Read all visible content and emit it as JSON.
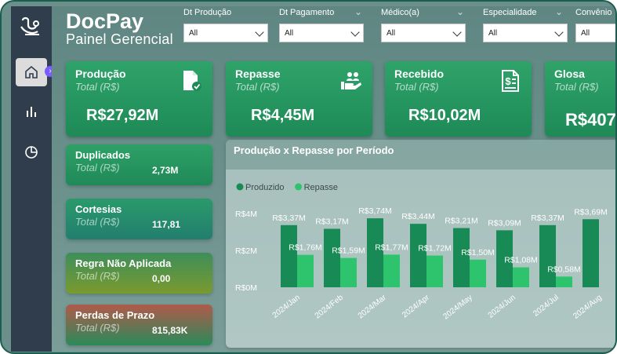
{
  "app": {
    "title": "DocPay",
    "subtitle": "Painel Gerencial"
  },
  "filters": [
    {
      "label": "Dt Produção",
      "value": "All"
    },
    {
      "label": "Dt Pagamento",
      "value": "All"
    },
    {
      "label": "Médico(a)",
      "value": "All"
    },
    {
      "label": "Especialidade",
      "value": "All"
    },
    {
      "label": "Convênio",
      "value": "All"
    }
  ],
  "kpis": [
    {
      "title": "Produção",
      "subtitle": "Total (R$)",
      "value": "R$27,92M",
      "icon": "document-check-icon"
    },
    {
      "title": "Repasse",
      "subtitle": "Total (R$)",
      "value": "R$4,45M",
      "icon": "hand-people-icon"
    },
    {
      "title": "Recebido",
      "subtitle": "Total (R$)",
      "value": "R$10,02M",
      "icon": "receipt-dollar-icon"
    },
    {
      "title": "Glosa",
      "subtitle": "Total (R$)",
      "value": "R$407",
      "icon": ""
    }
  ],
  "small_cards": [
    {
      "title": "Duplicados",
      "subtitle": "Total (R$)",
      "value": "2,73M",
      "color_top": "#2ea067",
      "color_bottom": "#1f8a58"
    },
    {
      "title": "Cortesias",
      "subtitle": "Total (R$)",
      "value": "117,81",
      "color_top": "#2a9a6a",
      "color_bottom": "#227e6e"
    },
    {
      "title": "Regra Não Aplicada",
      "subtitle": "Total (R$)",
      "value": "0,00",
      "color_top": "#3d8e5a",
      "color_bottom": "#7a9a2e"
    },
    {
      "title": "Perdas de Prazo",
      "subtitle": "Total (R$)",
      "value": "815,83K",
      "color_top": "#b05a4a",
      "color_bottom": "#2a8a5a"
    }
  ],
  "chart_data": {
    "type": "bar",
    "title": "Produção x Repasse por Período",
    "categories": [
      "2024/Jan",
      "2024/Feb",
      "2024/Mar",
      "2024/Apr",
      "2024/May",
      "2024/Jun",
      "2024/Jul",
      "2024/Aug"
    ],
    "series": [
      {
        "name": "Produzido",
        "color": "#178a55",
        "values": [
          3.37,
          3.17,
          3.74,
          3.44,
          3.21,
          3.09,
          3.37,
          3.69
        ],
        "labels": [
          "R$3,37M",
          "R$3,17M",
          "R$3,74M",
          "R$3,44M",
          "R$3,21M",
          "R$3,09M",
          "R$3,37M",
          "R$3,69M"
        ]
      },
      {
        "name": "Repasse",
        "color": "#2ec46d",
        "values": [
          1.76,
          1.59,
          1.77,
          1.72,
          1.5,
          1.08,
          0.58,
          null
        ],
        "labels": [
          "R$1,76M",
          "R$1,59M",
          "R$1,77M",
          "R$1,72M",
          "R$1,50M",
          "R$1,08M",
          "R$0,58M",
          ""
        ]
      }
    ],
    "yticks": [
      "R$4M",
      "R$2M",
      "R$0M"
    ],
    "ylim": [
      0,
      4
    ],
    "legend": "top-left",
    "grid": false
  },
  "colors": {
    "sidebar": "#2f3d4d",
    "accent_green": "#1e8a57",
    "nav_badge": "#7b5cff"
  }
}
